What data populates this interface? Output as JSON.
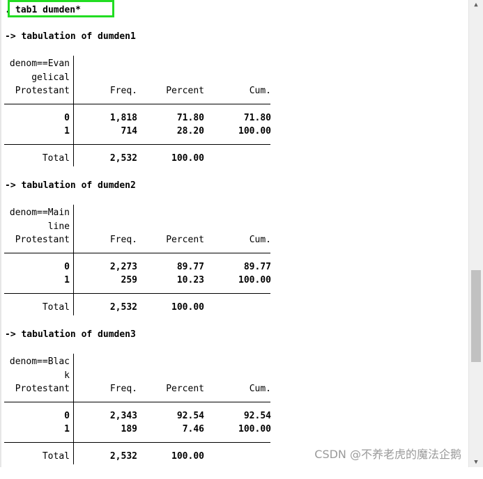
{
  "command": {
    "prompt": ".",
    "text": "tab1 dumden*"
  },
  "tables": [
    {
      "heading": "-> tabulation of dumden1",
      "label_lines": [
        "denom==Evan",
        "gelical",
        "Protestant"
      ],
      "columns": [
        "Freq.",
        "Percent",
        "Cum."
      ],
      "rows": [
        {
          "value": "0",
          "freq": "1,818",
          "percent": "71.80",
          "cum": "71.80"
        },
        {
          "value": "1",
          "freq": "714",
          "percent": "28.20",
          "cum": "100.00"
        }
      ],
      "total": {
        "label": "Total",
        "freq": "2,532",
        "percent": "100.00"
      }
    },
    {
      "heading": "-> tabulation of dumden2",
      "label_lines": [
        "denom==Main",
        "line",
        "Protestant"
      ],
      "columns": [
        "Freq.",
        "Percent",
        "Cum."
      ],
      "rows": [
        {
          "value": "0",
          "freq": "2,273",
          "percent": "89.77",
          "cum": "89.77"
        },
        {
          "value": "1",
          "freq": "259",
          "percent": "10.23",
          "cum": "100.00"
        }
      ],
      "total": {
        "label": "Total",
        "freq": "2,532",
        "percent": "100.00"
      }
    },
    {
      "heading": "-> tabulation of dumden3",
      "label_lines": [
        "denom==Blac",
        "k",
        "Protestant"
      ],
      "columns": [
        "Freq.",
        "Percent",
        "Cum."
      ],
      "rows": [
        {
          "value": "0",
          "freq": "2,343",
          "percent": "92.54",
          "cum": "92.54"
        },
        {
          "value": "1",
          "freq": "189",
          "percent": "7.46",
          "cum": "100.00"
        }
      ],
      "total": {
        "label": "Total",
        "freq": "2,532",
        "percent": "100.00"
      }
    }
  ],
  "watermark": "CSDN @不养老虎的魔法企鹅",
  "scrollbar": {
    "up_icon": "chevron-up-icon",
    "down_icon": "chevron-down-icon"
  },
  "colors": {
    "command_highlight": "#22dd22",
    "scroll_thumb": "#c1c1c1"
  }
}
